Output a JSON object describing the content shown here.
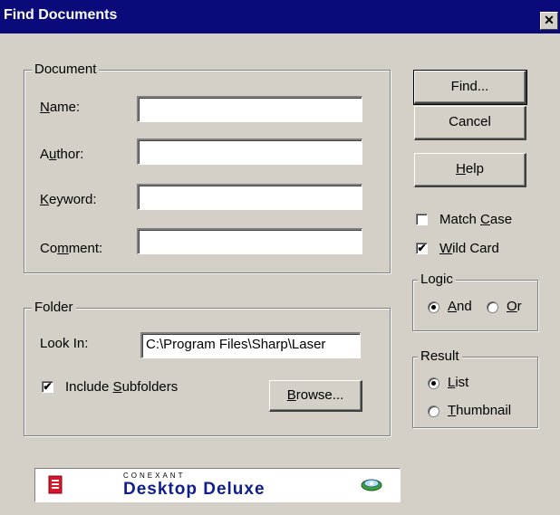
{
  "window": {
    "title": "Find Documents",
    "close_glyph": "✕"
  },
  "document_group": {
    "legend": "Document",
    "name_label": "Name:",
    "name_value": "",
    "author_label": "Author:",
    "author_value": "",
    "keyword_label": "Keyword:",
    "keyword_value": "",
    "comment_label": "Comment:",
    "comment_value": ""
  },
  "folder_group": {
    "legend": "Folder",
    "look_in_label": "Look In:",
    "look_in_value": "C:\\Program Files\\Sharp\\Laser",
    "include_subfolders_label": "Include Subfolders",
    "include_subfolders_checked": true,
    "browse_label": "Browse..."
  },
  "buttons": {
    "find": "Find...",
    "cancel": "Cancel",
    "help": "Help"
  },
  "options": {
    "match_case_label": "Match Case",
    "match_case_checked": false,
    "wild_card_label": "Wild Card",
    "wild_card_checked": true
  },
  "logic_group": {
    "legend": "Logic",
    "and_label": "And",
    "or_label": "Or",
    "selected": "And"
  },
  "result_group": {
    "legend": "Result",
    "list_label": "List",
    "thumbnail_label": "Thumbnail",
    "selected": "List"
  },
  "banner": {
    "brand_small": "CONEXANT",
    "brand_big": "Desktop Deluxe"
  },
  "check_glyph": "✔",
  "colors": {
    "title_bar": "#0a0a7a",
    "dialog_bg": "#d4d0c8",
    "brand_blue": "#0f1e8c"
  }
}
